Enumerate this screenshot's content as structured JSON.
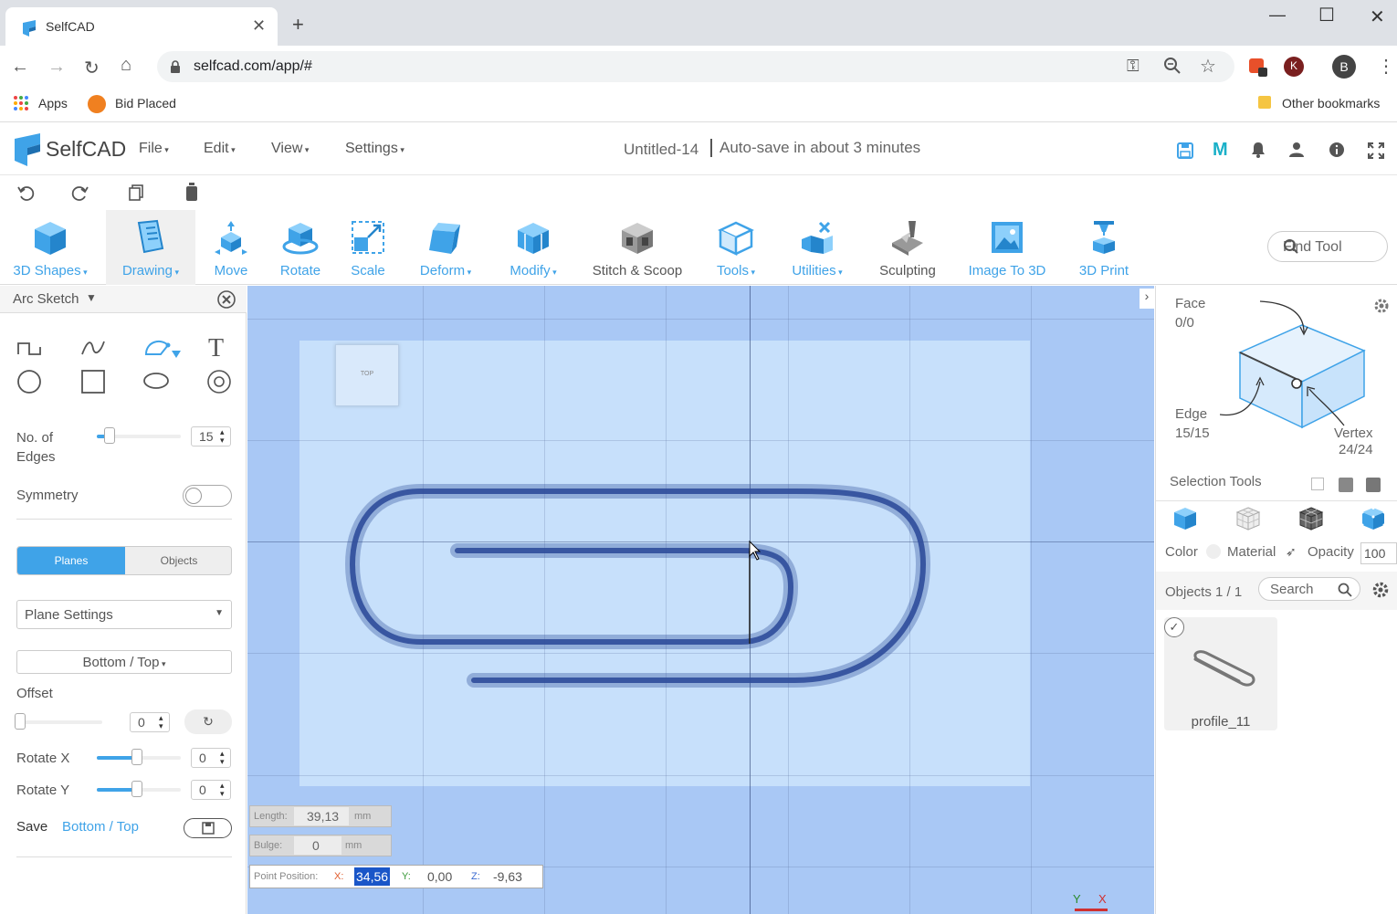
{
  "browser": {
    "tab_title": "SelfCAD",
    "url": "selfcad.com/app/#",
    "bookmarks": [
      "Apps",
      "Bid Placed"
    ],
    "other_bookmarks": "Other bookmarks",
    "profile_initial": "B",
    "ext_initial": "K"
  },
  "app": {
    "logo_text": "SelfCAD",
    "menus": [
      "File",
      "Edit",
      "View",
      "Settings"
    ],
    "doc_title": "Untitled-14",
    "autosave": "Auto-save in about 3 minutes",
    "ribbon": [
      {
        "label": "3D Shapes",
        "icon": "cube-icon"
      },
      {
        "label": "Drawing",
        "icon": "drawing-icon"
      },
      {
        "label": "Move",
        "icon": "move-icon"
      },
      {
        "label": "Rotate",
        "icon": "rotate-icon"
      },
      {
        "label": "Scale",
        "icon": "scale-icon"
      },
      {
        "label": "Deform",
        "icon": "deform-icon"
      },
      {
        "label": "Modify",
        "icon": "modify-icon"
      },
      {
        "label": "Stitch & Scoop",
        "icon": "stitch-scoop-icon"
      },
      {
        "label": "Tools",
        "icon": "tools-icon"
      },
      {
        "label": "Utilities",
        "icon": "utilities-icon"
      },
      {
        "label": "Sculpting",
        "icon": "sculpting-icon"
      },
      {
        "label": "Image To 3D",
        "icon": "image-to-3d-icon"
      },
      {
        "label": "3D Print",
        "icon": "3d-print-icon"
      }
    ],
    "find_tool": "Find Tool"
  },
  "left_panel": {
    "title": "Arc Sketch",
    "edges_label": "No. of Edges",
    "edges_value": "15",
    "edges_fraction": 0.15,
    "symmetry_label": "Symmetry",
    "symmetry_on": false,
    "tabs": [
      "Planes",
      "Objects"
    ],
    "plane_settings": "Plane Settings",
    "plane_select": "Bottom / Top",
    "offset_label": "Offset",
    "offset_value": "0",
    "rotate_x_label": "Rotate X",
    "rotate_x_value": "0",
    "rotate_y_label": "Rotate Y",
    "rotate_y_value": "0",
    "save_label": "Save",
    "save_plane": "Bottom / Top"
  },
  "viewport": {
    "cube_label": "TOP",
    "length_label": "Length:",
    "length_value": "39,13",
    "length_unit": "mm",
    "bulge_label": "Bulge:",
    "bulge_value": "0",
    "bulge_unit": "mm",
    "point_label": "Point Position:",
    "x_label": "X:",
    "x_value": "34,56",
    "y_label": "Y:",
    "y_value": "0,00",
    "z_label": "Z:",
    "z_value": "-9,63",
    "axis_y": "Y",
    "axis_x": "X"
  },
  "right_panel": {
    "face_label": "Face",
    "face_count": "0/0",
    "edge_label": "Edge",
    "edge_count": "15/15",
    "vertex_label": "Vertex",
    "vertex_count": "24/24",
    "selection_tools": "Selection Tools",
    "color_label": "Color",
    "material_label": "Material",
    "opacity_label": "Opacity",
    "opacity_value": "100",
    "objects_label": "Objects 1 / 1",
    "search_placeholder": "Search",
    "object_name": "profile_11"
  },
  "colors": {
    "accent": "#3fa3e8",
    "viewport": "#a9c8f5",
    "plane": "#c7e0fb"
  }
}
